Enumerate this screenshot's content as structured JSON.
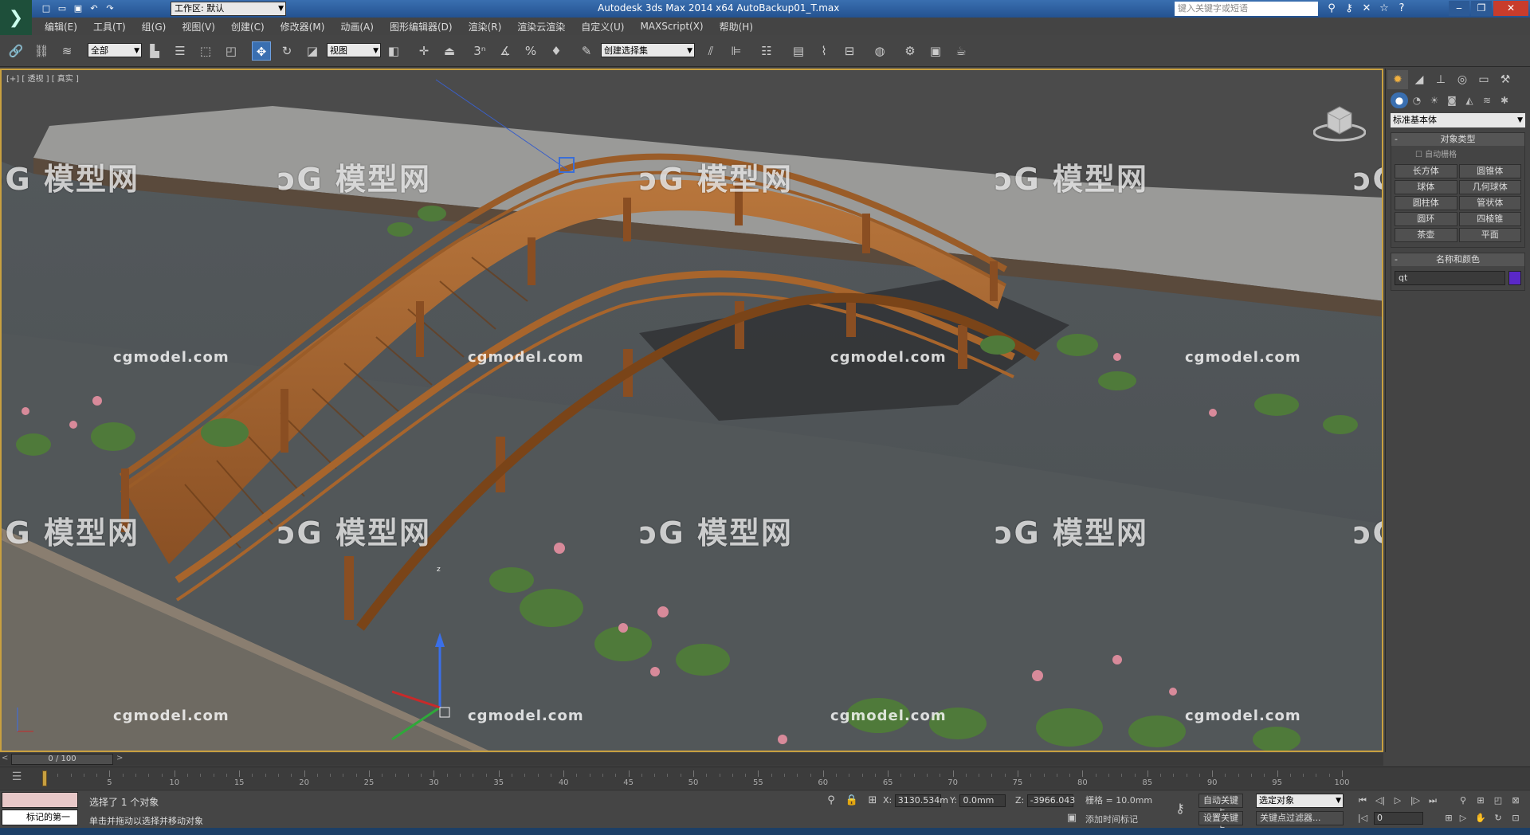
{
  "window": {
    "workspace_label": "工作区: 默认",
    "title": "Autodesk 3ds Max  2014 x64      AutoBackup01_T.max",
    "search_placeholder": "键入关键字或短语"
  },
  "menu": [
    "编辑(E)",
    "工具(T)",
    "组(G)",
    "视图(V)",
    "创建(C)",
    "修改器(M)",
    "动画(A)",
    "图形编辑器(D)",
    "渲染(R)",
    "渲染云渲染",
    "自定义(U)",
    "MAXScript(X)",
    "帮助(H)"
  ],
  "toolbar": {
    "filter_select": "全部",
    "ref_coord_select": "视图",
    "named_selection": "创建选择集",
    "snap_label": "3",
    "angle_snap": "%"
  },
  "viewport": {
    "label": "[+] [ 透视 ] [ 真实 ]",
    "watermark_logo": "模型网",
    "watermark_url": "cgmodel.com",
    "gizmo_axis_z": "z"
  },
  "command_panel": {
    "category_select": "标准基本体",
    "object_type_title": "对象类型",
    "auto_grid": "自动栅格",
    "objects": [
      "长方体",
      "圆锥体",
      "球体",
      "几何球体",
      "圆柱体",
      "管状体",
      "圆环",
      "四棱锥",
      "茶壶",
      "平面"
    ],
    "name_color_title": "名称和颜色",
    "object_name": "qt",
    "object_color": "#5a28c8"
  },
  "timeline": {
    "position": "0 / 100",
    "current_frame": 0,
    "total_frames": 100,
    "tick_labels": [
      "0",
      "5",
      "10",
      "15",
      "20",
      "25",
      "30",
      "35",
      "40",
      "45",
      "50",
      "55",
      "60",
      "65",
      "70",
      "75",
      "80",
      "85",
      "90",
      "95",
      "100"
    ]
  },
  "status": {
    "selection_info": "选择了 1 个对象",
    "prompt": "单击并拖动以选择并移动对象",
    "marker_text": "标记的第一",
    "x_label": "X:",
    "x_value": "3130.534m",
    "y_label": "Y:",
    "y_value": "0.0mm",
    "z_label": "Z:",
    "z_value": "-3966.043",
    "grid": "栅格 = 10.0mm",
    "add_time_tag": "添加时间标记",
    "auto_key": "自动关键点",
    "set_key": "设置关键点",
    "key_select": "选定对象",
    "key_filters": "关键点过滤器...",
    "frame_field": "0"
  }
}
